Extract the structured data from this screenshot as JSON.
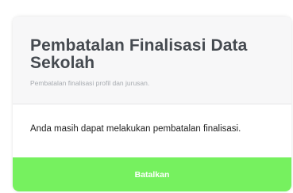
{
  "card": {
    "title": "Pembatalan Finalisasi Data Sekolah",
    "subtitle": "Pembatalan finalisasi profil dan jurusan.",
    "message": "Anda masih dapat melakukan pembatalan finalisasi.",
    "button_label": "Batalkan"
  },
  "colors": {
    "button_bg": "#76f15f",
    "header_bg": "#f7f7f8",
    "title_text": "#454a50",
    "subtitle_text": "#a7abb0"
  }
}
